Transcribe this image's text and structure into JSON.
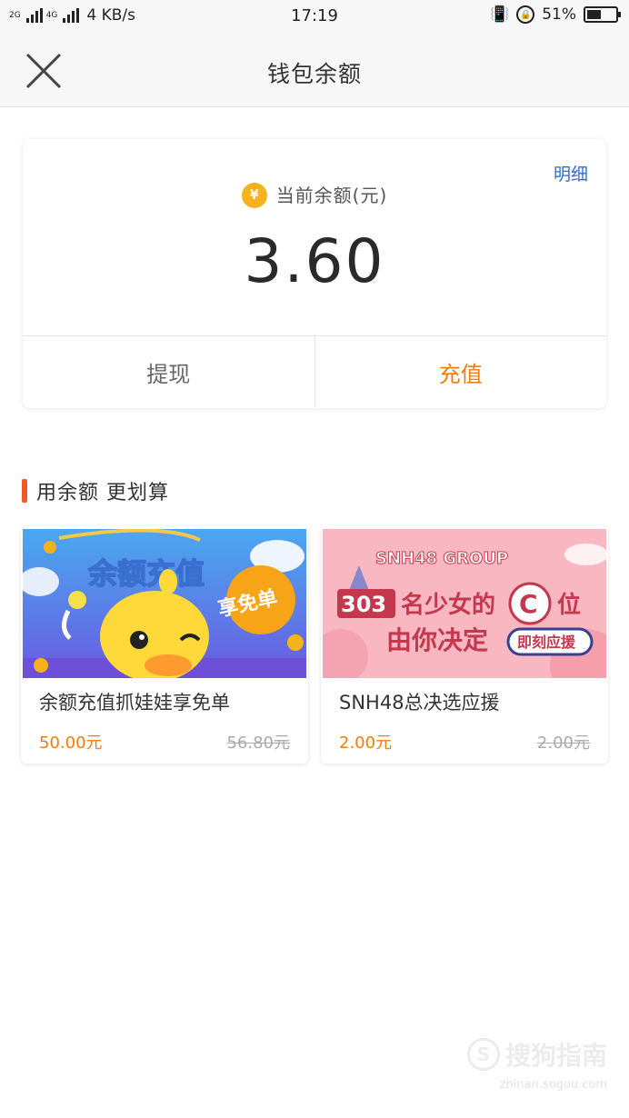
{
  "status_bar": {
    "network_1": "2G",
    "network_2": "4G",
    "network_3": "2G",
    "speed": "4 KB/s",
    "time": "17:19",
    "battery": "51%",
    "battery_level": 0.51
  },
  "header": {
    "title": "钱包余额",
    "close_icon": "close-icon"
  },
  "balance": {
    "detail_link": "明细",
    "label": "当前余额(元)",
    "amount": "3.60",
    "coin_symbol": "¥",
    "withdraw_label": "提现",
    "recharge_label": "充值"
  },
  "section": {
    "title": "用余额 更划算"
  },
  "promos": [
    {
      "banner_title": "余额充值",
      "banner_badge": "享免单",
      "name": "余额充值抓娃娃享免单",
      "price": "50.00元",
      "original_price": "56.80元"
    },
    {
      "banner_brand": "SNH48 GROUP",
      "banner_line1_num": "303",
      "banner_line1": "名少女的",
      "banner_c": "C",
      "banner_line1_end": "位",
      "banner_line2": "由你决定",
      "banner_cta": "即刻应援",
      "name": "SNH48总决选应援",
      "price": "2.00元",
      "original_price": "2.00元"
    }
  ],
  "watermark": {
    "text": "搜狗指南",
    "url": "zhinan.sogou.com"
  },
  "colors": {
    "accent_orange": "#f07d0c",
    "link_blue": "#2b6fcf",
    "section_bar": "#f25a22"
  }
}
